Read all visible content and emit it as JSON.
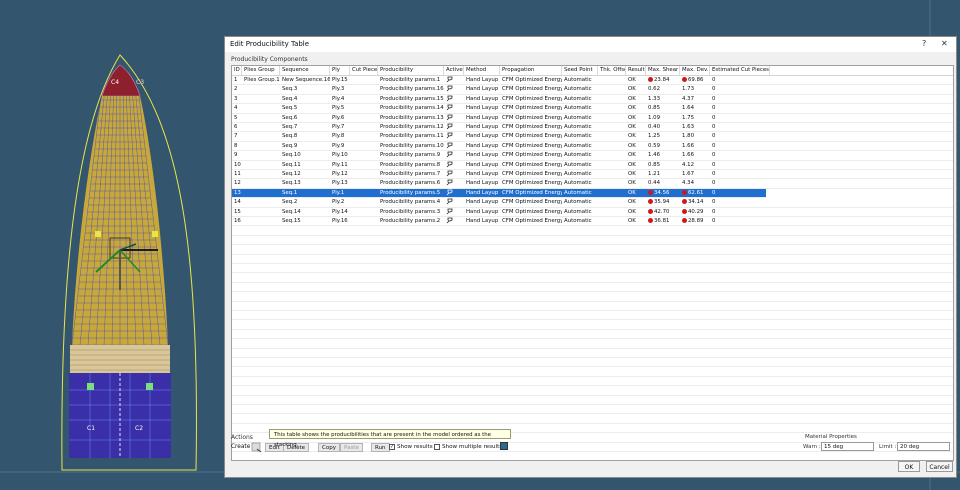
{
  "dialog": {
    "title": "Edit Producibility Table",
    "help_label": "?",
    "close_label": "✕",
    "group_title": "Producibility Components"
  },
  "table": {
    "columns": [
      "ID",
      "Plies Group",
      "Sequence",
      "Ply",
      "Cut Piece",
      "Producibility",
      "Active",
      "Method",
      "Propagation",
      "Seed Point",
      "Thk. Offset",
      "Result",
      "Max. Shear",
      "Max. Dev.",
      "Estimated Cut Pieces"
    ],
    "rows": [
      {
        "id": "1",
        "group": "Plies Group.1",
        "seq": "New Sequence.16",
        "ply": "Ply.15",
        "cut": "",
        "prod": "Producibility params.1",
        "method": "Hand Layup",
        "prop": "CFM Optimized Energy",
        "seed": "Automatic",
        "thk": "",
        "result": "OK",
        "shear": "23.84",
        "shear_red": true,
        "dev": "69.86",
        "dev_red": true,
        "pieces": "0",
        "selected": false
      },
      {
        "id": "2",
        "group": "",
        "seq": "Seq.3",
        "ply": "Ply.3",
        "cut": "",
        "prod": "Producibility params.16",
        "method": "Hand Layup",
        "prop": "CFM Optimized Energy",
        "seed": "Automatic",
        "thk": "",
        "result": "OK",
        "shear": "0.62",
        "shear_red": false,
        "dev": "1.73",
        "dev_red": false,
        "pieces": "0",
        "selected": false
      },
      {
        "id": "3",
        "group": "",
        "seq": "Seq.4",
        "ply": "Ply.4",
        "cut": "",
        "prod": "Producibility params.15",
        "method": "Hand Layup",
        "prop": "CFM Optimized Energy",
        "seed": "Automatic",
        "thk": "",
        "result": "OK",
        "shear": "1.33",
        "shear_red": false,
        "dev": "4.37",
        "dev_red": false,
        "pieces": "0",
        "selected": false
      },
      {
        "id": "4",
        "group": "",
        "seq": "Seq.5",
        "ply": "Ply.5",
        "cut": "",
        "prod": "Producibility params.14",
        "method": "Hand Layup",
        "prop": "CFM Optimized Energy",
        "seed": "Automatic",
        "thk": "",
        "result": "OK",
        "shear": "0.85",
        "shear_red": false,
        "dev": "1.64",
        "dev_red": false,
        "pieces": "0",
        "selected": false
      },
      {
        "id": "5",
        "group": "",
        "seq": "Seq.6",
        "ply": "Ply.6",
        "cut": "",
        "prod": "Producibility params.13",
        "method": "Hand Layup",
        "prop": "CFM Optimized Energy",
        "seed": "Automatic",
        "thk": "",
        "result": "OK",
        "shear": "1.09",
        "shear_red": false,
        "dev": "1.75",
        "dev_red": false,
        "pieces": "0",
        "selected": false
      },
      {
        "id": "6",
        "group": "",
        "seq": "Seq.7",
        "ply": "Ply.7",
        "cut": "",
        "prod": "Producibility params.12",
        "method": "Hand Layup",
        "prop": "CFM Optimized Energy",
        "seed": "Automatic",
        "thk": "",
        "result": "OK",
        "shear": "0.40",
        "shear_red": false,
        "dev": "1.63",
        "dev_red": false,
        "pieces": "0",
        "selected": false
      },
      {
        "id": "7",
        "group": "",
        "seq": "Seq.8",
        "ply": "Ply.8",
        "cut": "",
        "prod": "Producibility params.11",
        "method": "Hand Layup",
        "prop": "CFM Optimized Energy",
        "seed": "Automatic",
        "thk": "",
        "result": "OK",
        "shear": "1.25",
        "shear_red": false,
        "dev": "1.80",
        "dev_red": false,
        "pieces": "0",
        "selected": false
      },
      {
        "id": "8",
        "group": "",
        "seq": "Seq.9",
        "ply": "Ply.9",
        "cut": "",
        "prod": "Producibility params.10",
        "method": "Hand Layup",
        "prop": "CFM Optimized Energy",
        "seed": "Automatic",
        "thk": "",
        "result": "OK",
        "shear": "0.59",
        "shear_red": false,
        "dev": "1.66",
        "dev_red": false,
        "pieces": "0",
        "selected": false
      },
      {
        "id": "9",
        "group": "",
        "seq": "Seq.10",
        "ply": "Ply.10",
        "cut": "",
        "prod": "Producibility params.9",
        "method": "Hand Layup",
        "prop": "CFM Optimized Energy",
        "seed": "Automatic",
        "thk": "",
        "result": "OK",
        "shear": "1.46",
        "shear_red": false,
        "dev": "1.66",
        "dev_red": false,
        "pieces": "0",
        "selected": false
      },
      {
        "id": "10",
        "group": "",
        "seq": "Seq.11",
        "ply": "Ply.11",
        "cut": "",
        "prod": "Producibility params.8",
        "method": "Hand Layup",
        "prop": "CFM Optimized Energy",
        "seed": "Automatic",
        "thk": "",
        "result": "OK",
        "shear": "0.85",
        "shear_red": false,
        "dev": "4.12",
        "dev_red": false,
        "pieces": "0",
        "selected": false
      },
      {
        "id": "11",
        "group": "",
        "seq": "Seq.12",
        "ply": "Ply.12",
        "cut": "",
        "prod": "Producibility params.7",
        "method": "Hand Layup",
        "prop": "CFM Optimized Energy",
        "seed": "Automatic",
        "thk": "",
        "result": "OK",
        "shear": "1.21",
        "shear_red": false,
        "dev": "1.67",
        "dev_red": false,
        "pieces": "0",
        "selected": false
      },
      {
        "id": "12",
        "group": "",
        "seq": "Seq.13",
        "ply": "Ply.13",
        "cut": "",
        "prod": "Producibility params.6",
        "method": "Hand Layup",
        "prop": "CFM Optimized Energy",
        "seed": "Automatic",
        "thk": "",
        "result": "OK",
        "shear": "0.44",
        "shear_red": false,
        "dev": "4.34",
        "dev_red": false,
        "pieces": "0",
        "selected": false
      },
      {
        "id": "13",
        "group": "",
        "seq": "Seq.1",
        "ply": "Ply.1",
        "cut": "",
        "prod": "Producibility params.5",
        "method": "Hand Layup",
        "prop": "CFM Optimized Energy",
        "seed": "Automatic",
        "thk": "",
        "result": "OK",
        "shear": "34.56",
        "shear_red": true,
        "dev": "62.61",
        "dev_red": true,
        "pieces": "0",
        "selected": true
      },
      {
        "id": "14",
        "group": "",
        "seq": "Seq.2",
        "ply": "Ply.2",
        "cut": "",
        "prod": "Producibility params.4",
        "method": "Hand Layup",
        "prop": "CFM Optimized Energy",
        "seed": "Automatic",
        "thk": "",
        "result": "OK",
        "shear": "35.94",
        "shear_red": true,
        "dev": "34.14",
        "dev_red": true,
        "pieces": "0",
        "selected": false
      },
      {
        "id": "15",
        "group": "",
        "seq": "Seq.14",
        "ply": "Ply.14",
        "cut": "",
        "prod": "Producibility params.3",
        "method": "Hand Layup",
        "prop": "CFM Optimized Energy",
        "seed": "Automatic",
        "thk": "",
        "result": "OK",
        "shear": "42.70",
        "shear_red": true,
        "dev": "40.29",
        "dev_red": true,
        "pieces": "0",
        "selected": false
      },
      {
        "id": "16",
        "group": "",
        "seq": "Seq.15",
        "ply": "Ply.16",
        "cut": "",
        "prod": "Producibility params.2",
        "method": "Hand Layup",
        "prop": "CFM Optimized Energy",
        "seed": "Automatic",
        "thk": "",
        "result": "OK",
        "shear": "36.81",
        "shear_red": true,
        "dev": "28.89",
        "dev_red": true,
        "pieces": "0",
        "selected": false
      }
    ],
    "active_icon": "pin-icon",
    "dot_color": "#d01818",
    "selection_color": "#1f6fd1"
  },
  "actions": {
    "group_title": "Actions",
    "create_label": "Create",
    "edit_label": "Edit",
    "delete_label": "Delete",
    "copy_label": "Copy",
    "paste_label": "Paste",
    "run_label": "Run",
    "show_results_label": "Show results",
    "show_results_checked": true,
    "show_multiple_label": "Show multiple results",
    "show_multiple_checked": false,
    "tooltip": "This table shows the producibilities that are present in the model ordered as the stacking."
  },
  "material": {
    "group_title": "Material Properties",
    "warn_label": "Warn :",
    "warn_value": "15 deg",
    "limit_label": "Limit :",
    "limit_value": "20 deg"
  },
  "footer": {
    "ok_label": "OK",
    "cancel_label": "Cancel"
  },
  "viewport": {
    "labels": [
      "C4",
      "C3",
      "C1",
      "C2"
    ],
    "part_color": "#c9a83a",
    "mesh_color": "#2c3fd8",
    "band_color": "#3b2fa8"
  }
}
